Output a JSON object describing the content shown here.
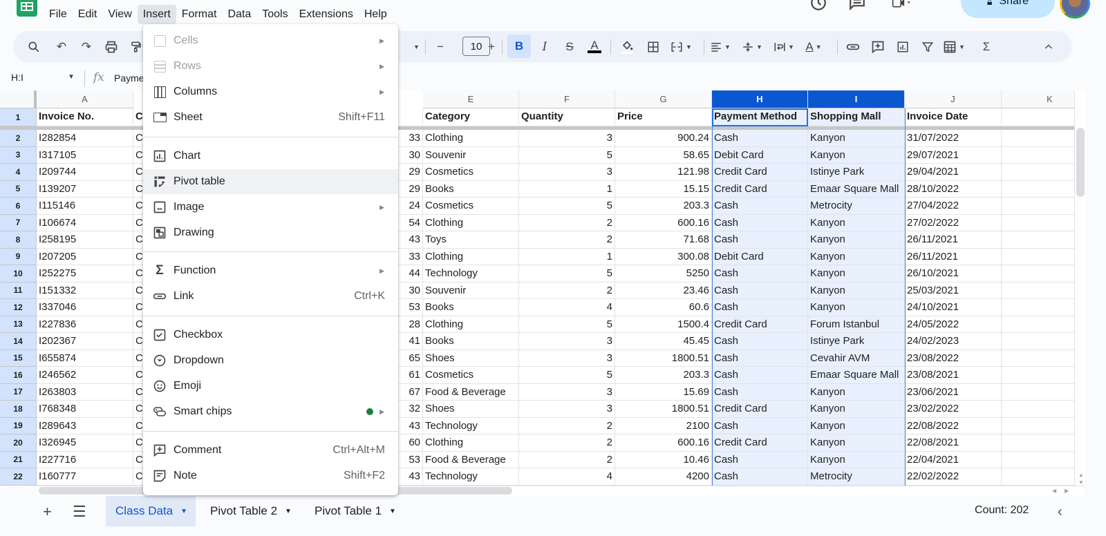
{
  "app": {
    "menu": [
      "File",
      "Edit",
      "View",
      "Insert",
      "Format",
      "Data",
      "Tools",
      "Extensions",
      "Help"
    ],
    "active_menu": "Insert",
    "share_label": "Share",
    "icons": [
      "history-icon",
      "comments-icon",
      "meet-icon",
      "lock-icon"
    ]
  },
  "toolbar": {
    "font_size": "10",
    "buttons": [
      "search",
      "undo",
      "redo",
      "print",
      "paint-format",
      "decrease-font-size",
      "increase-font-size",
      "bold",
      "italic",
      "strikethrough",
      "text-color",
      "fill-color",
      "borders",
      "merge-cells",
      "horizontal-align",
      "vertical-align",
      "text-wrapping",
      "text-rotation",
      "insert-link",
      "insert-comment",
      "insert-chart",
      "create-filter",
      "functions-menu",
      "sum",
      "collapse-toolbar"
    ],
    "bold_active": true
  },
  "formula_bar": {
    "name_box": "H:I",
    "fx": "fx",
    "formula": "Paymen"
  },
  "grid": {
    "column_headers": [
      "A",
      "E",
      "F",
      "G",
      "H",
      "I",
      "J",
      "K"
    ],
    "selected_columns": [
      "H",
      "I"
    ],
    "header_row": {
      "row_number": "1",
      "A": "Invoice No.",
      "B_partial": "C",
      "E": "Category",
      "F": "Quantity",
      "G": "Price",
      "H": "Payment Method",
      "I": "Shopping Mall",
      "J": "Invoice Date"
    },
    "rows": [
      {
        "n": "2",
        "a": "I282854",
        "b": "C",
        "d": "33",
        "e": "Clothing",
        "f": "3",
        "g": "900.24",
        "h": "Cash",
        "i": "Kanyon",
        "j": "31/07/2022"
      },
      {
        "n": "3",
        "a": "I317105",
        "b": "C",
        "d": "30",
        "e": "Souvenir",
        "f": "5",
        "g": "58.65",
        "h": "Debit Card",
        "i": "Kanyon",
        "j": "29/07/2021"
      },
      {
        "n": "4",
        "a": "I209744",
        "b": "C",
        "d": "29",
        "e": "Cosmetics",
        "f": "3",
        "g": "121.98",
        "h": "Credit Card",
        "i": "Istinye Park",
        "j": "29/04/2021"
      },
      {
        "n": "5",
        "a": "I139207",
        "b": "C",
        "d": "29",
        "e": "Books",
        "f": "1",
        "g": "15.15",
        "h": "Credit Card",
        "i": "Emaar Square Mall",
        "j": "28/10/2022"
      },
      {
        "n": "6",
        "a": "I115146",
        "b": "C",
        "d": "24",
        "e": "Cosmetics",
        "f": "5",
        "g": "203.3",
        "h": "Cash",
        "i": "Metrocity",
        "j": "27/04/2022"
      },
      {
        "n": "7",
        "a": "I106674",
        "b": "C",
        "d": "54",
        "e": "Clothing",
        "f": "2",
        "g": "600.16",
        "h": "Cash",
        "i": "Kanyon",
        "j": "27/02/2022"
      },
      {
        "n": "8",
        "a": "I258195",
        "b": "C",
        "d": "43",
        "e": "Toys",
        "f": "2",
        "g": "71.68",
        "h": "Cash",
        "i": "Kanyon",
        "j": "26/11/2021"
      },
      {
        "n": "9",
        "a": "I207205",
        "b": "C",
        "d": "33",
        "e": "Clothing",
        "f": "1",
        "g": "300.08",
        "h": "Debit Card",
        "i": "Kanyon",
        "j": "26/11/2021"
      },
      {
        "n": "10",
        "a": "I252275",
        "b": "C",
        "d": "44",
        "e": "Technology",
        "f": "5",
        "g": "5250",
        "h": "Cash",
        "i": "Kanyon",
        "j": "26/10/2021"
      },
      {
        "n": "11",
        "a": "I151332",
        "b": "C",
        "d": "30",
        "e": "Souvenir",
        "f": "2",
        "g": "23.46",
        "h": "Cash",
        "i": "Kanyon",
        "j": "25/03/2021"
      },
      {
        "n": "12",
        "a": "I337046",
        "b": "C",
        "d": "53",
        "e": "Books",
        "f": "4",
        "g": "60.6",
        "h": "Cash",
        "i": "Kanyon",
        "j": "24/10/2021"
      },
      {
        "n": "13",
        "a": "I227836",
        "b": "C",
        "d": "28",
        "e": "Clothing",
        "f": "5",
        "g": "1500.4",
        "h": "Credit Card",
        "i": "Forum Istanbul",
        "j": "24/05/2022"
      },
      {
        "n": "14",
        "a": "I202367",
        "b": "C",
        "d": "41",
        "e": "Books",
        "f": "3",
        "g": "45.45",
        "h": "Cash",
        "i": "Istinye Park",
        "j": "24/02/2023"
      },
      {
        "n": "15",
        "a": "I655874",
        "b": "C",
        "d": "65",
        "e": "Shoes",
        "f": "3",
        "g": "1800.51",
        "h": "Cash",
        "i": "Cevahir AVM",
        "j": "23/08/2022"
      },
      {
        "n": "16",
        "a": "I246562",
        "b": "C",
        "d": "61",
        "e": "Cosmetics",
        "f": "5",
        "g": "203.3",
        "h": "Cash",
        "i": "Emaar Square Mall",
        "j": "23/08/2021"
      },
      {
        "n": "17",
        "a": "I263803",
        "b": "C",
        "d": "67",
        "e": "Food & Beverage",
        "f": "3",
        "g": "15.69",
        "h": "Cash",
        "i": "Kanyon",
        "j": "23/06/2021"
      },
      {
        "n": "18",
        "a": "I768348",
        "b": "C",
        "d": "32",
        "e": "Shoes",
        "f": "3",
        "g": "1800.51",
        "h": "Credit Card",
        "i": "Kanyon",
        "j": "23/02/2022"
      },
      {
        "n": "19",
        "a": "I289643",
        "b": "C",
        "d": "43",
        "e": "Technology",
        "f": "2",
        "g": "2100",
        "h": "Cash",
        "i": "Kanyon",
        "j": "22/08/2022"
      },
      {
        "n": "20",
        "a": "I326945",
        "b": "C",
        "d": "60",
        "e": "Clothing",
        "f": "2",
        "g": "600.16",
        "h": "Credit Card",
        "i": "Kanyon",
        "j": "22/08/2021"
      },
      {
        "n": "21",
        "a": "I227716",
        "b": "C",
        "d": "53",
        "e": "Food & Beverage",
        "f": "2",
        "g": "10.46",
        "h": "Cash",
        "i": "Kanyon",
        "j": "22/04/2021"
      },
      {
        "n": "22",
        "a": "I160777",
        "b": "C",
        "d": "43",
        "e": "Technology",
        "f": "4",
        "g": "4200",
        "h": "Cash",
        "i": "Metrocity",
        "j": "22/02/2022"
      }
    ]
  },
  "insert_menu": {
    "items": [
      {
        "label": "Cells",
        "icon": "cells-icon",
        "submenu": true,
        "disabled": true
      },
      {
        "label": "Rows",
        "icon": "rows-icon",
        "submenu": true,
        "disabled": true
      },
      {
        "label": "Columns",
        "icon": "columns-icon",
        "submenu": true
      },
      {
        "label": "Sheet",
        "icon": "sheet-icon",
        "shortcut": "Shift+F11"
      },
      {
        "label": "Chart",
        "icon": "chart-icon"
      },
      {
        "label": "Pivot table",
        "icon": "pivot-table-icon",
        "hovered": true
      },
      {
        "label": "Image",
        "icon": "image-icon",
        "submenu": true
      },
      {
        "label": "Drawing",
        "icon": "drawing-icon"
      },
      {
        "label": "Function",
        "icon": "sigma-icon",
        "submenu": true
      },
      {
        "label": "Link",
        "icon": "link-icon",
        "shortcut": "Ctrl+K"
      },
      {
        "label": "Checkbox",
        "icon": "checkbox-icon"
      },
      {
        "label": "Dropdown",
        "icon": "dropdown-icon"
      },
      {
        "label": "Emoji",
        "icon": "emoji-icon"
      },
      {
        "label": "Smart chips",
        "icon": "smart-chips-icon",
        "submenu": true,
        "new_dot": true
      },
      {
        "label": "Comment",
        "icon": "comment-icon",
        "shortcut": "Ctrl+Alt+M"
      },
      {
        "label": "Note",
        "icon": "note-icon",
        "shortcut": "Shift+F2"
      }
    ]
  },
  "bottom_bar": {
    "sheets": [
      {
        "label": "Class Data",
        "active": true
      },
      {
        "label": "Pivot Table 2"
      },
      {
        "label": "Pivot Table 1"
      }
    ],
    "status": "Count: 202"
  },
  "colors": {
    "accent": "#0b57d0",
    "selection_fill": "#e8f0fe",
    "share_button": "#c2e7ff",
    "logo_green": "#1ea362",
    "new_dot": "#188038"
  }
}
